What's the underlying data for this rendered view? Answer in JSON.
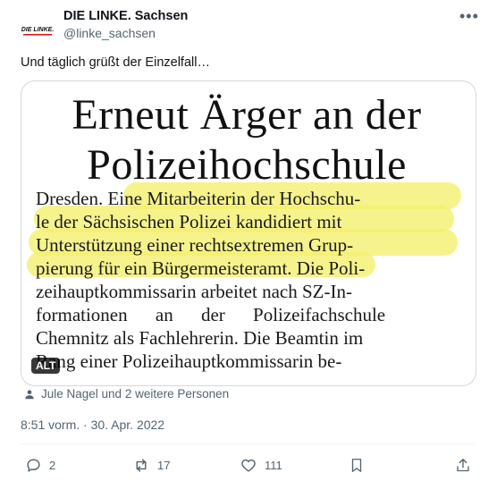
{
  "account": {
    "avatar_text": "DIE LINKE.",
    "display_name": "DIE LINKE. Sachsen",
    "handle": "@linke_sachsen"
  },
  "tweet": {
    "text": "Und täglich grüßt der Einzelfall…",
    "timestamp": "8:51 vorm. · 30. Apr. 2022"
  },
  "media": {
    "alt_badge": "ALT",
    "headline_line1": "Erneut Ärger an der",
    "headline_line2": "Polizeihochschule",
    "article_lines": [
      "Dresden. Eine Mitarbeiterin der Hochschu-",
      "le der Sächsischen Polizei kandidiert mit",
      "Unterstützung einer rechtsextremen Grup-",
      "pierung für ein Bürgermeisteramt. Die Poli-",
      "zeihauptkommissarin arbeitet nach SZ-In-",
      "formationen an der Polizeifachschule",
      "Chemnitz als Fachlehrerin. Die Beamtin im",
      "Rang einer Polizeihauptkommissarin be-"
    ],
    "highlight_color": "#f3ef6c"
  },
  "social_context": {
    "liked_by": "Jule Nagel und 2 weitere Personen"
  },
  "actions": {
    "reply_count": "2",
    "retweet_count": "17",
    "like_count": "111"
  },
  "colors": {
    "text_primary": "#0f1419",
    "text_secondary": "#536471",
    "border": "#cfd9de"
  }
}
